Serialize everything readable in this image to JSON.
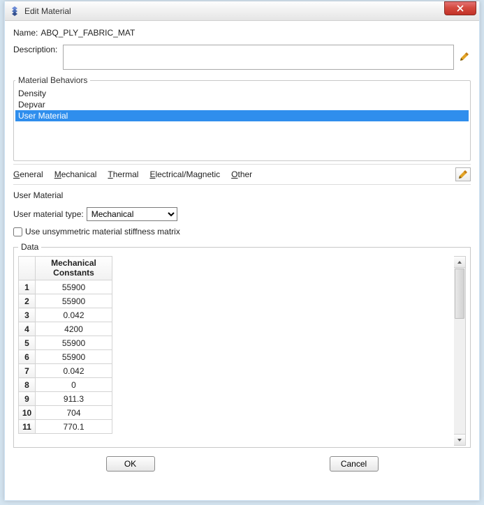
{
  "window": {
    "title": "Edit Material"
  },
  "name": {
    "label": "Name:",
    "value": "ABQ_PLY_FABRIC_MAT"
  },
  "description": {
    "label": "Description:",
    "value": ""
  },
  "behaviors": {
    "legend": "Material Behaviors",
    "items": [
      {
        "label": "Density",
        "selected": false
      },
      {
        "label": "Depvar",
        "selected": false
      },
      {
        "label": "User Material",
        "selected": true
      }
    ]
  },
  "menus": {
    "general": "General",
    "mechanical": "Mechanical",
    "thermal": "Thermal",
    "em": "Electrical/Magnetic",
    "other": "Other"
  },
  "userMaterial": {
    "section_title": "User Material",
    "type_label": "User material type:",
    "type_value": "Mechanical",
    "unsym_label": "Use unsymmetric material stiffness matrix",
    "unsym_checked": false
  },
  "dataGrid": {
    "legend": "Data",
    "column_header": "Mechanical\nConstants",
    "rows": [
      {
        "idx": "1",
        "val": "55900"
      },
      {
        "idx": "2",
        "val": "55900"
      },
      {
        "idx": "3",
        "val": "0.042"
      },
      {
        "idx": "4",
        "val": "4200"
      },
      {
        "idx": "5",
        "val": "55900"
      },
      {
        "idx": "6",
        "val": "55900"
      },
      {
        "idx": "7",
        "val": "0.042"
      },
      {
        "idx": "8",
        "val": "0"
      },
      {
        "idx": "9",
        "val": "911.3"
      },
      {
        "idx": "10",
        "val": "704"
      },
      {
        "idx": "11",
        "val": "770.1"
      }
    ]
  },
  "buttons": {
    "ok": "OK",
    "cancel": "Cancel"
  }
}
